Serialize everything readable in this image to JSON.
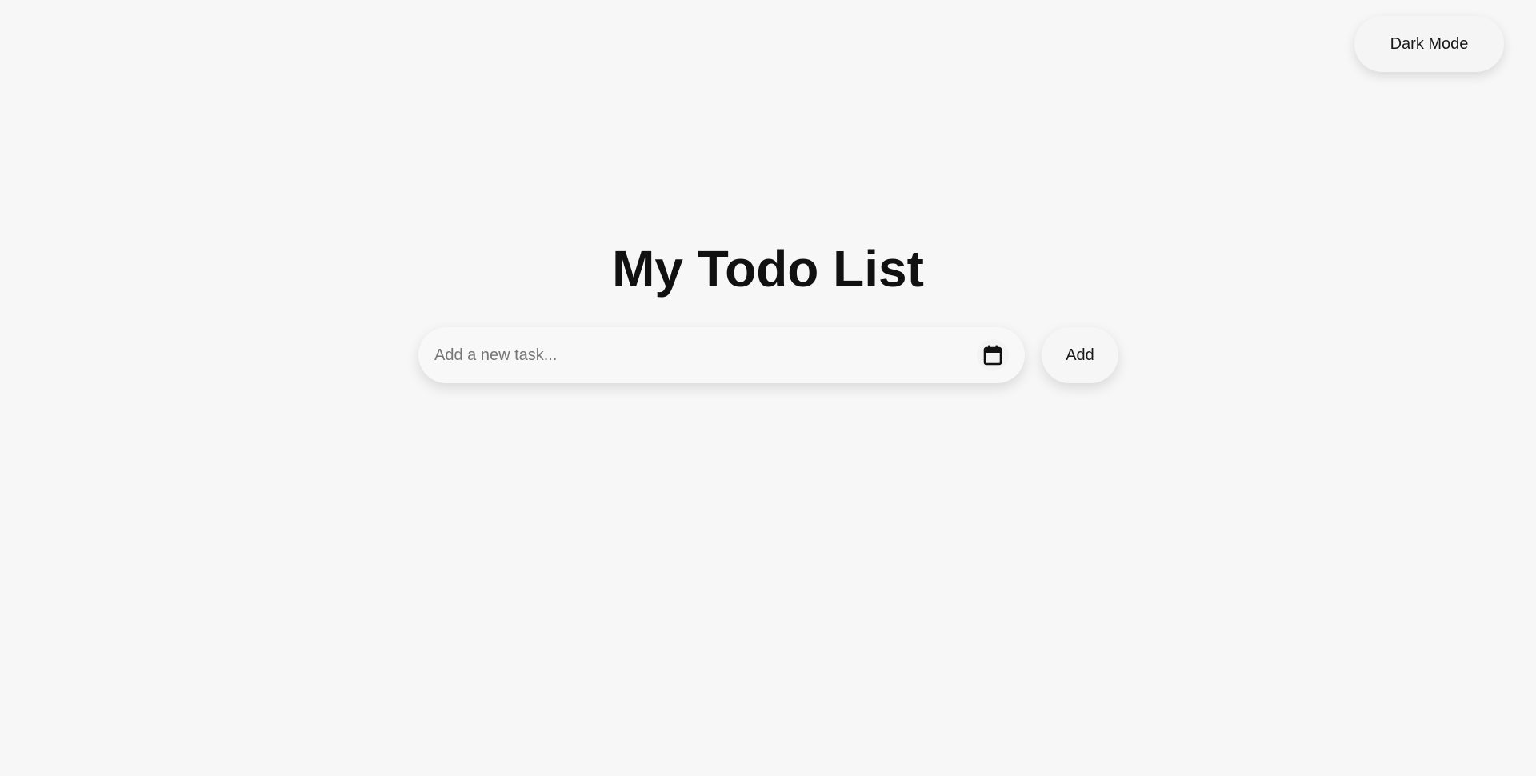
{
  "header": {
    "theme_toggle_label": "Dark Mode"
  },
  "main": {
    "title": "My Todo List",
    "task_input": {
      "value": "",
      "placeholder": "Add a new task..."
    },
    "calendar_icon": "calendar-icon",
    "add_label": "Add"
  },
  "colors": {
    "background": "#f7f7f7",
    "text": "#111111",
    "placeholder": "#767676"
  }
}
